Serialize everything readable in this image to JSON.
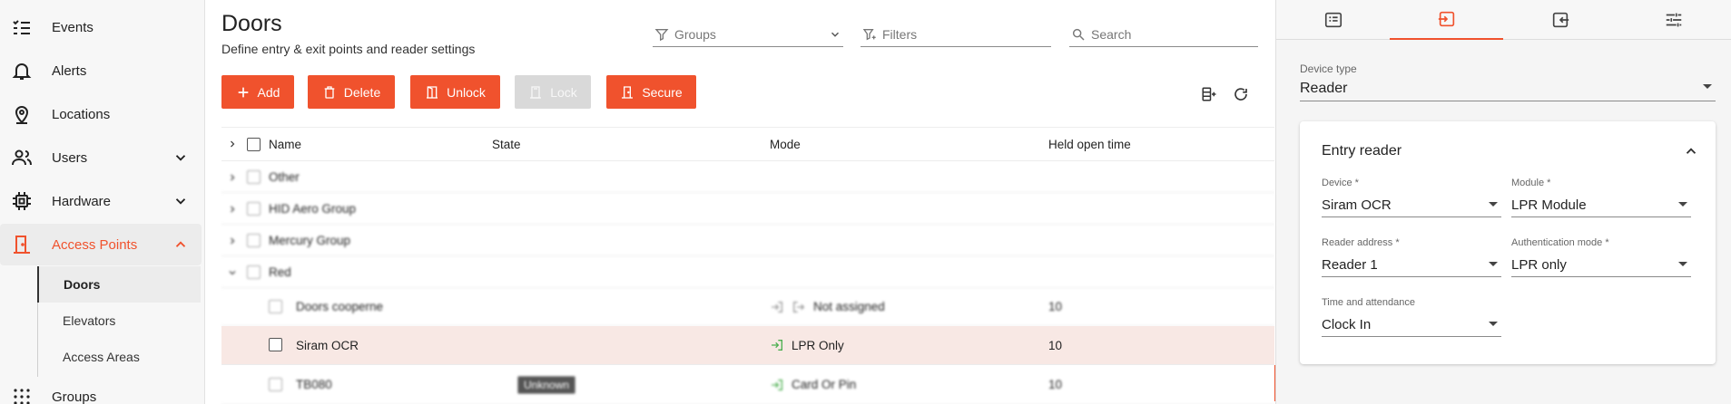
{
  "sidebar": {
    "items": [
      {
        "label": "Events",
        "icon": "events-icon"
      },
      {
        "label": "Alerts",
        "icon": "bell-icon"
      },
      {
        "label": "Locations",
        "icon": "location-pin-icon"
      },
      {
        "label": "Users",
        "icon": "users-icon"
      },
      {
        "label": "Hardware",
        "icon": "chip-icon"
      },
      {
        "label": "Access Points",
        "icon": "door-icon"
      },
      {
        "label": "Groups",
        "icon": "grid-icon"
      }
    ],
    "subitems": [
      {
        "label": "Doors"
      },
      {
        "label": "Elevators"
      },
      {
        "label": "Access Areas"
      }
    ]
  },
  "page": {
    "title": "Doors",
    "subtitle": "Define entry & exit points and reader settings"
  },
  "filters": {
    "groups_placeholder": "Groups",
    "filters_placeholder": "Filters",
    "search_placeholder": "Search"
  },
  "toolbar": {
    "add": "Add",
    "delete": "Delete",
    "unlock": "Unlock",
    "lock": "Lock",
    "secure": "Secure"
  },
  "table": {
    "columns": [
      "Name",
      "State",
      "Mode",
      "Held open time"
    ],
    "groups": [
      "Other",
      "HID Aero Group",
      "Mercury Group",
      "Red"
    ],
    "rows": [
      {
        "name": "Doors cooperne",
        "state": "",
        "mode": "Not assigned",
        "held": "10"
      },
      {
        "name": "Siram OCR",
        "state": "",
        "mode": "LPR Only",
        "held": "10"
      },
      {
        "name": "TB080",
        "state": "Unknown",
        "mode": "Card Or Pin",
        "held": "10"
      }
    ]
  },
  "panel": {
    "device_type_label": "Device type",
    "device_type_value": "Reader",
    "card_title": "Entry reader",
    "fields": {
      "device_label": "Device *",
      "device_value": "Siram OCR",
      "module_label": "Module *",
      "module_value": "LPR Module",
      "reader_addr_label": "Reader address *",
      "reader_addr_value": "Reader 1",
      "auth_mode_label": "Authentication mode *",
      "auth_mode_value": "LPR only",
      "time_att_label": "Time and attendance",
      "time_att_value": "Clock In"
    }
  },
  "colors": {
    "accent": "#f0522d",
    "selected_row": "#f8e8e4",
    "mode_icon": "#4caf50"
  }
}
